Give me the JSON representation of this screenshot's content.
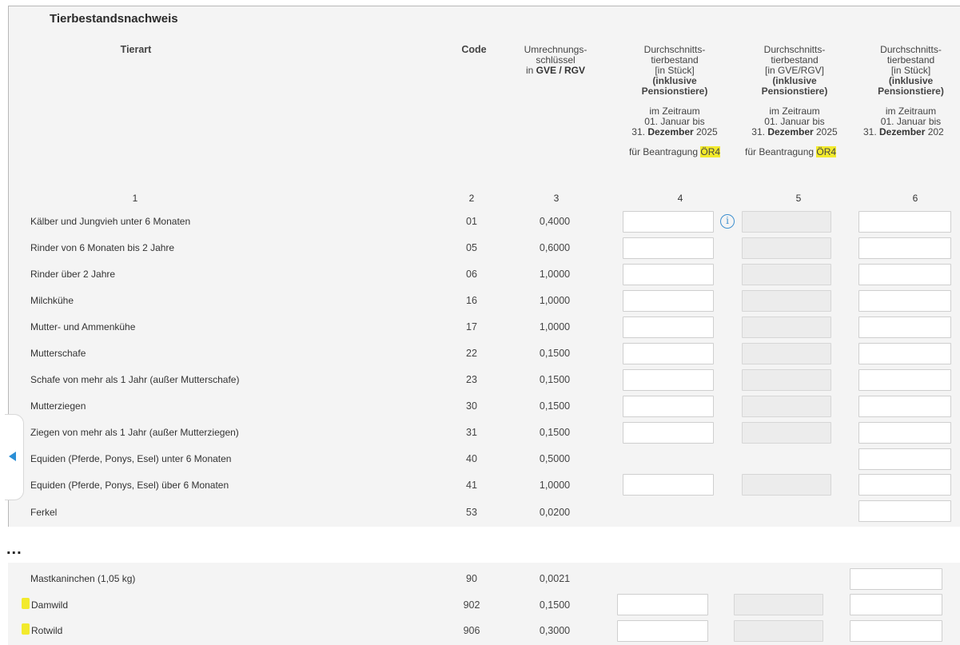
{
  "title": "Tierbestandsnachweis",
  "headers": {
    "col1": "Tierart",
    "col2": "Code",
    "col3_l1": "Umrechnungs-",
    "col3_l2": "schlüssel",
    "col3_l3a": "in ",
    "col3_l3b": "GVE / RGV",
    "col4_l1": "Durchschnitts-",
    "col4_l2": "tierbestand",
    "col4_l3": "[in Stück]",
    "col4_l4": "(inklusive",
    "col4_l5": "Pensionstiere)",
    "col4_z1": "im Zeitraum",
    "col4_z2": "01. Januar bis",
    "col4_z3a": "31. ",
    "col4_z3b": "Dezember",
    "col4_z3c": " 2025",
    "col4_b1": "für Beantragung ",
    "col4_b2": "ÖR4",
    "col5_l1": "Durchschnitts-",
    "col5_l2": "tierbestand",
    "col5_l3": "[in GVE/RGV]",
    "col5_l4": "(inklusive",
    "col5_l5": "Pensionstiere)",
    "col5_z1": "im Zeitraum",
    "col5_z2": "01. Januar bis",
    "col5_z3a": "31. ",
    "col5_z3b": "Dezember",
    "col5_z3c": " 2025",
    "col5_b1": "für Beantragung ",
    "col5_b2": "ÖR4",
    "col6_l1": "Durchschnitts-",
    "col6_l2": "tierbestand",
    "col6_l3": "[in Stück]",
    "col6_l4": "(inklusive",
    "col6_l5": "Pensionstiere)",
    "col6_z1": "im Zeitraum",
    "col6_z2": "01. Januar bis",
    "col6_z3a": "31. ",
    "col6_z3b": "Dezember",
    "col6_z3c": " 202"
  },
  "column_numbers": [
    "1",
    "2",
    "3",
    "4",
    "5",
    "6"
  ],
  "rows": [
    {
      "label": "Kälber und Jungvieh unter 6 Monaten",
      "code": "01",
      "factor": "0,4000"
    },
    {
      "label": "Rinder von 6 Monaten bis 2 Jahre",
      "code": "05",
      "factor": "0,6000"
    },
    {
      "label": "Rinder über 2 Jahre",
      "code": "06",
      "factor": "1,0000"
    },
    {
      "label": "Milchkühe",
      "code": "16",
      "factor": "1,0000"
    },
    {
      "label": "Mutter- und Ammenkühe",
      "code": "17",
      "factor": "1,0000"
    },
    {
      "label": "Mutterschafe",
      "code": "22",
      "factor": "0,1500"
    },
    {
      "label": "Schafe von mehr als 1 Jahr (außer Mutterschafe)",
      "code": "23",
      "factor": "0,1500"
    },
    {
      "label": "Mutterziegen",
      "code": "30",
      "factor": "0,1500"
    },
    {
      "label": "Ziegen von mehr als 1 Jahr (außer Mutterziegen)",
      "code": "31",
      "factor": "0,1500"
    },
    {
      "label": "Equiden (Pferde, Ponys, Esel) unter 6 Monaten",
      "code": "40",
      "factor": "0,5000"
    },
    {
      "label": "Equiden (Pferde, Ponys, Esel) über 6 Monaten",
      "code": "41",
      "factor": "1,0000"
    },
    {
      "label": "Ferkel",
      "code": "53",
      "factor": "0,0200"
    }
  ],
  "ellipsis": "...",
  "rows_bottom": [
    {
      "label": "Mastkaninchen (1,05 kg)",
      "code": "90",
      "factor": "0,0021"
    },
    {
      "label": "Damwild",
      "code": "902",
      "factor": "0,1500"
    },
    {
      "label": "Rotwild",
      "code": "906",
      "factor": "0,3000"
    }
  ],
  "icons": {
    "info": "info-icon",
    "collapse": "arrow-left-icon"
  },
  "colors": {
    "highlight": "#f2ea2c",
    "info": "#3d8fcf",
    "panel": "#f4f4f4"
  }
}
